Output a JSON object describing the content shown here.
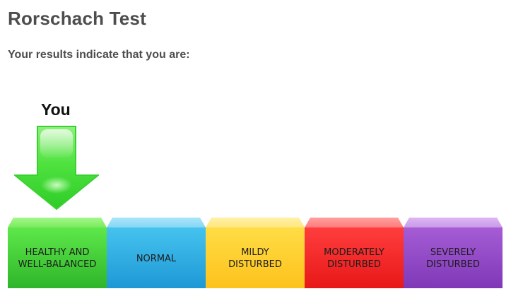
{
  "header": {
    "title": "Rorschach Test",
    "subtitle": "Your results indicate that you are:"
  },
  "indicator": {
    "label": "You",
    "icon": "down-arrow-icon",
    "color": "#4be346",
    "selected_index": 0
  },
  "scale": {
    "segments": [
      {
        "label": "HEALTHY AND\nWELL-BALANCED",
        "color": "#4cd93a"
      },
      {
        "label": "NORMAL",
        "color": "#2fb0e6"
      },
      {
        "label": "MILDY\nDISTURBED",
        "color": "#fed232"
      },
      {
        "label": "MODERATELY\nDISTURBED",
        "color": "#f52a2a"
      },
      {
        "label": "SEVERELY\nDISTURBED",
        "color": "#9449c8"
      }
    ]
  }
}
